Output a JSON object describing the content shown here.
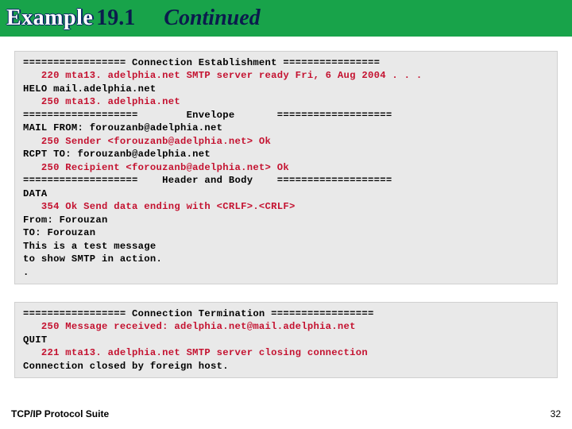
{
  "title": {
    "example": "Example",
    "number": "19.1",
    "continued": "Continued"
  },
  "terminal1": {
    "l1": "================= Connection Establishment ================",
    "l2": "   220 mta13. adelphia.net SMTP server ready Fri, 6 Aug 2004 . . .",
    "l3": "HELO mail.adelphia.net",
    "l4": "   250 mta13. adelphia.net",
    "l5": "===================        Envelope       ===================",
    "l6": "MAIL FROM: forouzanb@adelphia.net",
    "l7": "   250 Sender <forouzanb@adelphia.net> Ok",
    "l8": "RCPT TO: forouzanb@adelphia.net",
    "l9": "   250 Recipient <forouzanb@adelphia.net> Ok",
    "l10": "===================    Header and Body    ===================",
    "l11": "DATA",
    "l12": "   354 Ok Send data ending with <CRLF>.<CRLF>",
    "l13": "From: Forouzan",
    "l14": "TO: Forouzan",
    "l15": "",
    "l16": "This is a test message",
    "l17": "to show SMTP in action.",
    "l18": "."
  },
  "terminal2": {
    "l1": "================= Connection Termination =================",
    "l2": "   250 Message received: adelphia.net@mail.adelphia.net",
    "l3": "QUIT",
    "l4": "   221 mta13. adelphia.net SMTP server closing connection",
    "l5": "Connection closed by foreign host."
  },
  "footer": {
    "left": "TCP/IP Protocol Suite",
    "page": "32"
  }
}
